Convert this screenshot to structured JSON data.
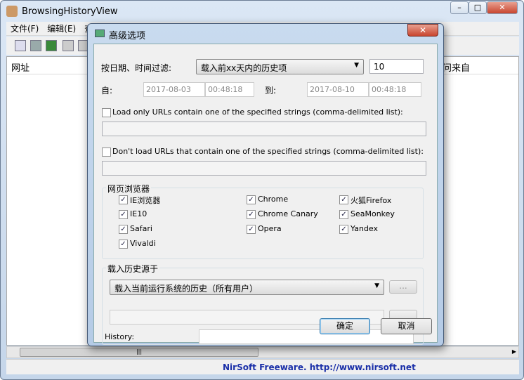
{
  "window": {
    "title": "BrowsingHistoryView"
  },
  "menu": [
    "文件(F)",
    "编辑(E)",
    "查"
  ],
  "list": {
    "col_url": "网址",
    "col_from": "问来自"
  },
  "status": {
    "text": "NirSoft Freeware.  http://www.nirsoft.net"
  },
  "dialog": {
    "title": "高级选项",
    "close": "✕",
    "filter_label": "按日期、时间过滤:",
    "filter_value": "载入前xx天内的历史项",
    "days": "10",
    "from_label": "自:",
    "from_date": "2017-08-03",
    "from_time": "00:48:18",
    "to_label": "到:",
    "to_date": "2017-08-10",
    "to_time": "00:48:18",
    "load_only_label": "Load only URLs contain one of the specified strings (comma-delimited list):",
    "load_only_value": "",
    "dont_load_label": "Don't load URLs that contain one of the specified strings (comma-delimited list):",
    "dont_load_value": "",
    "browsers_group": "网页浏览器",
    "browsers": [
      {
        "label": "IE浏览器",
        "checked": true
      },
      {
        "label": "Chrome",
        "checked": true
      },
      {
        "label": "火狐Firefox",
        "checked": true
      },
      {
        "label": "IE10",
        "checked": true
      },
      {
        "label": "Chrome Canary",
        "checked": true
      },
      {
        "label": "SeaMonkey",
        "checked": true
      },
      {
        "label": "Safari",
        "checked": true
      },
      {
        "label": "Opera",
        "checked": true
      },
      {
        "label": "Yandex",
        "checked": true
      },
      {
        "label": "Vivaldi",
        "checked": true
      }
    ],
    "source_group": "载入历史源于",
    "source_value": "载入当前运行系统的历史（所有用户）",
    "browse_btn": "...",
    "history_label": "History:",
    "ok": "确定",
    "cancel": "取消"
  }
}
